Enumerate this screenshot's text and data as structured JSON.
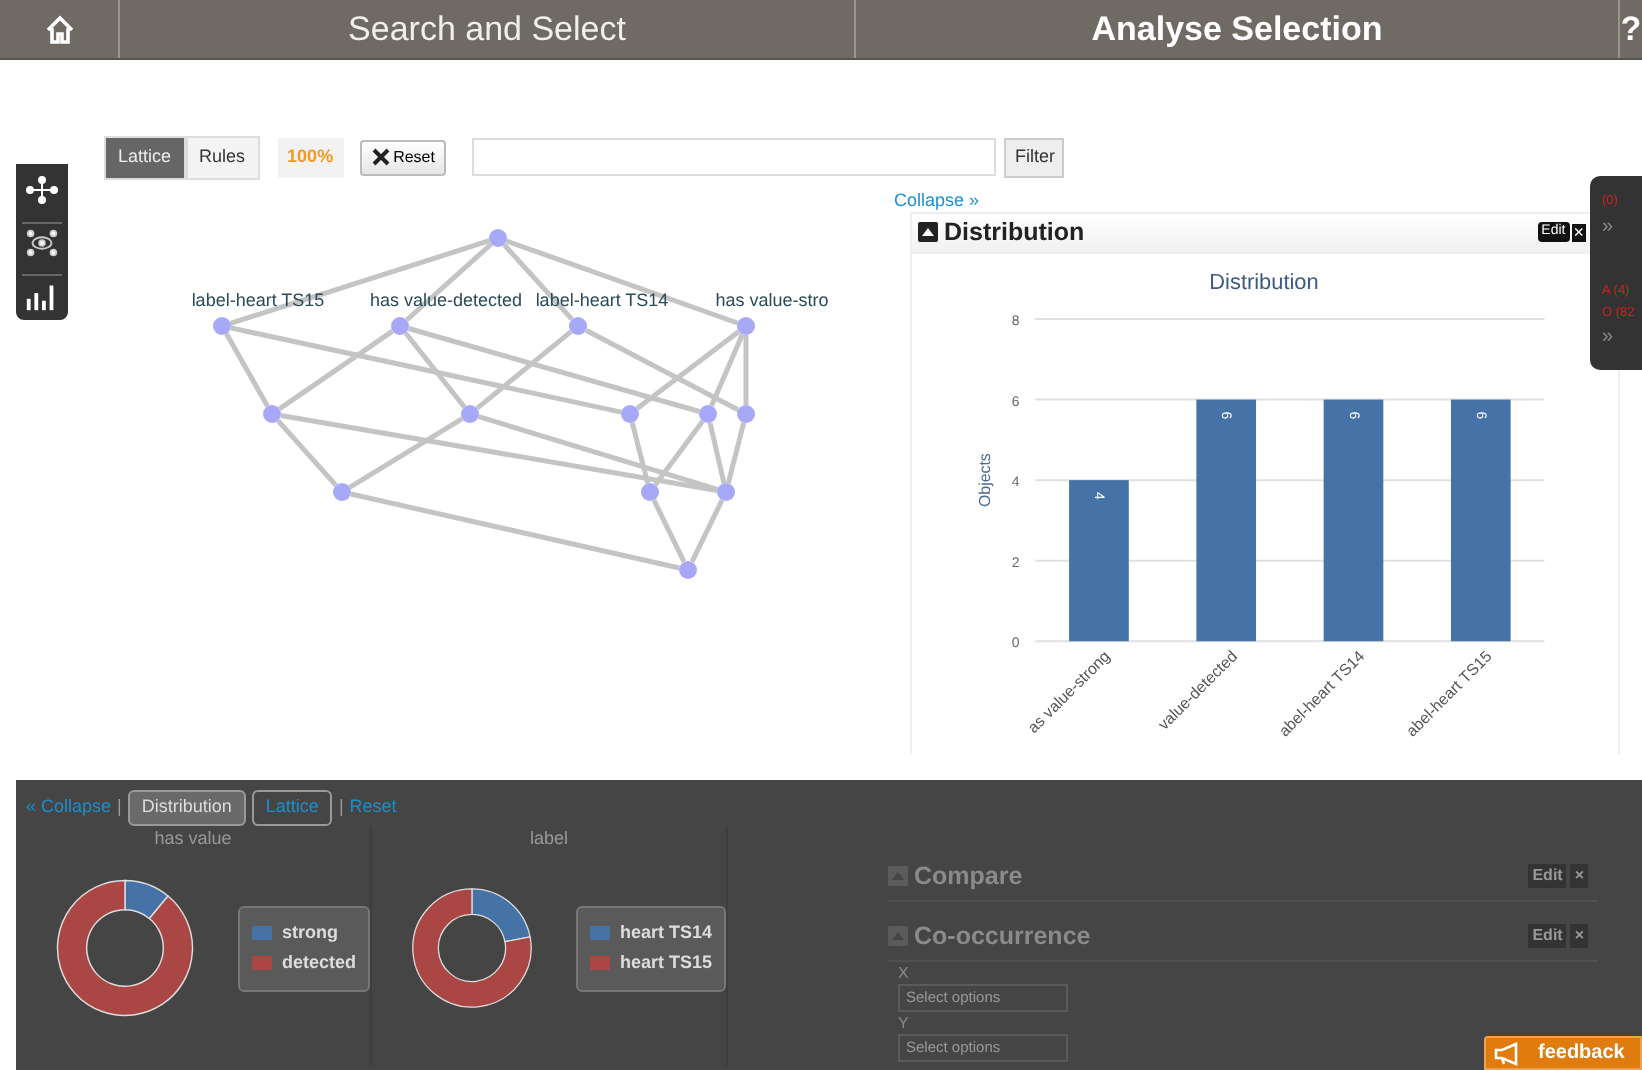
{
  "nav": {
    "tabs": [
      {
        "label": "Search and Select",
        "selected": false
      },
      {
        "label": "Analyse Selection",
        "selected": true
      }
    ],
    "help": "?"
  },
  "toolbar": {
    "views": [
      {
        "label": "Lattice",
        "selected": true
      },
      {
        "label": "Rules",
        "selected": false
      }
    ],
    "zoom": "100%",
    "reset": "Reset",
    "filter": "Filter"
  },
  "collapse_link": "Collapse »",
  "lattice": {
    "labels": [
      "label-heart TS15",
      "has value-detected",
      "label-heart TS14",
      "has value-stro"
    ]
  },
  "side_panel": {
    "items": [
      {
        "text": "(0)",
        "kind": "count"
      },
      {
        "text": "»",
        "kind": "expand"
      },
      {
        "text": "A (4)",
        "kind": "count"
      },
      {
        "text": "O (82",
        "kind": "count"
      },
      {
        "text": "»",
        "kind": "expand"
      }
    ]
  },
  "distribution": {
    "title": "Distribution",
    "edit": "Edit",
    "close": "×",
    "chart_data": {
      "type": "bar",
      "title": "Distribution",
      "ylabel": "Objects",
      "categories": [
        "as value-strong",
        "value-detected",
        "abel-heart TS14",
        "abel-heart TS15"
      ],
      "series": [
        {
          "color": "#4572a7",
          "values": [
            4,
            6,
            6,
            6
          ]
        }
      ],
      "ylim": [
        0,
        8
      ],
      "grid": true,
      "yticks": [
        0,
        2,
        4,
        6,
        8
      ],
      "data_labels": true
    }
  },
  "bottom": {
    "collapse": "« Collapse",
    "separators": [
      "|",
      "|"
    ],
    "tabs": [
      {
        "label": "Distribution",
        "selected": true
      },
      {
        "label": "Lattice",
        "selected": false
      }
    ],
    "reset": "Reset",
    "sections": [
      {
        "title": "has value",
        "legend": [
          {
            "label": "strong",
            "color": "#4572a7"
          },
          {
            "label": "detected",
            "color": "#aa4643"
          }
        ]
      },
      {
        "title": "label",
        "legend": [
          {
            "label": "heart TS14",
            "color": "#4572a7"
          },
          {
            "label": "heart TS15",
            "color": "#aa4643"
          }
        ]
      }
    ],
    "dimmed_panels": [
      {
        "title": "Compare",
        "edit": "Edit",
        "close": "×"
      },
      {
        "title": "Co-occurrence",
        "edit": "Edit",
        "close": "×",
        "fields": [
          {
            "label": "X",
            "placeholder": "Select options"
          },
          {
            "label": "Y",
            "placeholder": "Select options"
          }
        ]
      }
    ]
  },
  "feedback": "feedback"
}
